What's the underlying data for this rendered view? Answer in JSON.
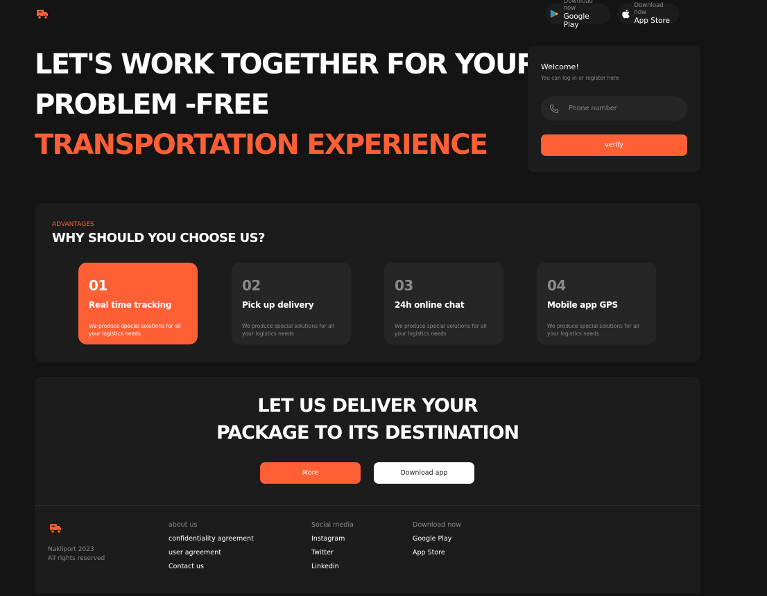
{
  "header": {
    "google_play": {
      "small": "Download now",
      "big": "Google Play"
    },
    "app_store": {
      "small": "Download now",
      "big": "App Store"
    }
  },
  "hero": {
    "line1": "LET'S WORK TOGETHER FOR YOUR",
    "line2": "PROBLEM -FREE",
    "line3": "TRANSPORTATION EXPERIENCE"
  },
  "login": {
    "welcome": "Welcome!",
    "subtitle": "You can log in or register here",
    "phone_placeholder": "Phone number",
    "verify_label": "verify"
  },
  "advantages": {
    "eyebrow": "ADVANTAGES",
    "title": "WHY SHOULD YOU CHOOSE US?",
    "items": [
      {
        "num": "01",
        "title": "Real time tracking",
        "desc": "We produce special solutions for all your logistics needs"
      },
      {
        "num": "02",
        "title": "Pick up delivery",
        "desc": "We produce special solutions for all your logistics needs"
      },
      {
        "num": "03",
        "title": "24h online chat",
        "desc": "We produce special solutions for all your logistics needs"
      },
      {
        "num": "04",
        "title": "Mobile app GPS",
        "desc": "We produce special solutions for all your logistics needs"
      }
    ]
  },
  "cta": {
    "line1": "LET US DELIVER YOUR",
    "line2": "PACKAGE TO ITS DESTINATION",
    "more_label": "More",
    "download_label": "Download app"
  },
  "footer": {
    "company": "Nakilport 2023",
    "rights": "All rights reserved",
    "col1": {
      "head": "about us",
      "links": [
        "confidentiality agreement",
        "user agreement",
        "Contact us"
      ]
    },
    "col2": {
      "head": "Social media",
      "links": [
        "Instagram",
        "Twitter",
        "Linkedin"
      ]
    },
    "col3": {
      "head": "Download now",
      "links": [
        "Google Play",
        "App Store"
      ]
    }
  },
  "colors": {
    "accent": "#ff5f35",
    "background": "#141414",
    "card": "#1c1c1c"
  },
  "icons": [
    "truck-logo-icon",
    "google-play-icon",
    "apple-icon",
    "phone-icon"
  ]
}
